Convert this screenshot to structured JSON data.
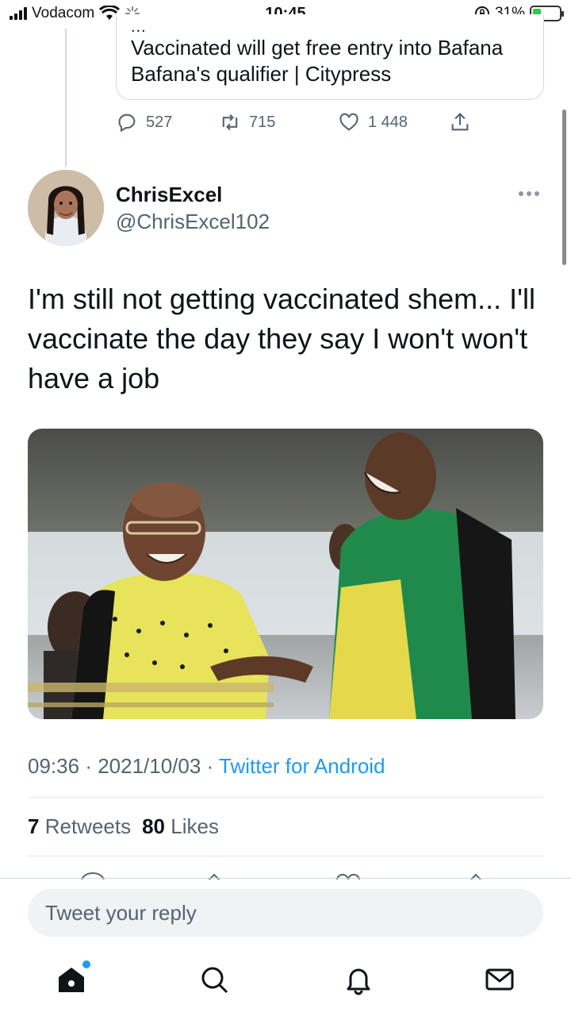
{
  "status_bar": {
    "carrier": "Vodacom",
    "time": "10:45",
    "battery": "31%"
  },
  "quoted_card": {
    "clipped_text": "...",
    "headline": "Vaccinated will get free entry into Bafana Bafana's qualifier | Citypress"
  },
  "quoted_actions": {
    "replies": "527",
    "retweets": "715",
    "likes": "1 448"
  },
  "tweet": {
    "name": "ChrisExcel",
    "handle": "@ChrisExcel102",
    "text": "I'm still not getting vaccinated shem... I'll vaccinate the day they say I won't won't have a job",
    "time": "09:36",
    "date": "2021/10/03",
    "source": "Twitter for Android",
    "retweets_count": "7",
    "retweets_label": "Retweets",
    "likes_count": "80",
    "likes_label": "Likes"
  },
  "reply": {
    "placeholder": "Tweet your reply"
  },
  "tabs": [
    "home",
    "search",
    "notifications",
    "messages"
  ],
  "icons": {
    "reply": "reply-icon",
    "retweet": "retweet-icon",
    "like": "heart-icon",
    "share": "share-icon"
  },
  "colors": {
    "accent": "#1d9bf0",
    "text": "#0f1419",
    "muted": "#536471"
  }
}
